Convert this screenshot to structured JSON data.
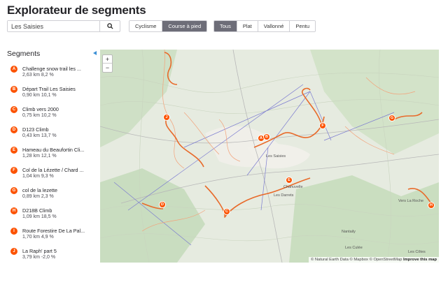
{
  "header": {
    "title": "Explorateur de segments"
  },
  "search": {
    "value": "Les Saisies",
    "button_icon": "search-icon"
  },
  "activity_toggle": {
    "options": [
      "Cyclisme",
      "Course à pied"
    ],
    "selected": "Course à pied"
  },
  "terrain_toggle": {
    "options": [
      "Tous",
      "Plat",
      "Vallonné",
      "Pentu"
    ],
    "selected": "Tous"
  },
  "sidebar": {
    "title": "Segments"
  },
  "segments": [
    {
      "letter": "A",
      "name": "Challenge snow trail les ...",
      "meta": "2,63 km   8,2 %"
    },
    {
      "letter": "B",
      "name": "Départ Trail Les Saisies",
      "meta": "0,90 km   10,1 %"
    },
    {
      "letter": "C",
      "name": "Climb vers 2000",
      "meta": "0,75 km   10,2 %"
    },
    {
      "letter": "D",
      "name": "D123 Climb",
      "meta": "0,43 km   13,7 %"
    },
    {
      "letter": "E",
      "name": "Hameau du Beaufortin Cli...",
      "meta": "1,28 km   12,1 %"
    },
    {
      "letter": "F",
      "name": "Col de la Lézette / Chard ...",
      "meta": "1,04 km   9,3 %"
    },
    {
      "letter": "G",
      "name": "col de la lezette",
      "meta": "0,89 km   2,3 %"
    },
    {
      "letter": "H",
      "name": "D218B Climb",
      "meta": "1,09 km   18,5 %"
    },
    {
      "letter": "I",
      "name": "Route Forestire De La Pal...",
      "meta": "1,70 km   4,9 %"
    },
    {
      "letter": "J",
      "name": "La Raph' part 5",
      "meta": "3,79 km   -2,0 %"
    }
  ],
  "map": {
    "zoom_in": "+",
    "zoom_out": "−",
    "place_labels": {
      "saisies": "Les Saisies",
      "chanuvelle": "Chanuvelle",
      "darrets": "Les Darrets",
      "combe": "Vers La Roche",
      "nantaily": "Nantaily",
      "culee": "Les Culée",
      "cotes": "Les Côtes"
    },
    "attribution": {
      "text": "© Natural Earth Data © Mapbox © OpenStreetMap",
      "improve": "Improve this map"
    },
    "accent_color": "#fc5200"
  }
}
